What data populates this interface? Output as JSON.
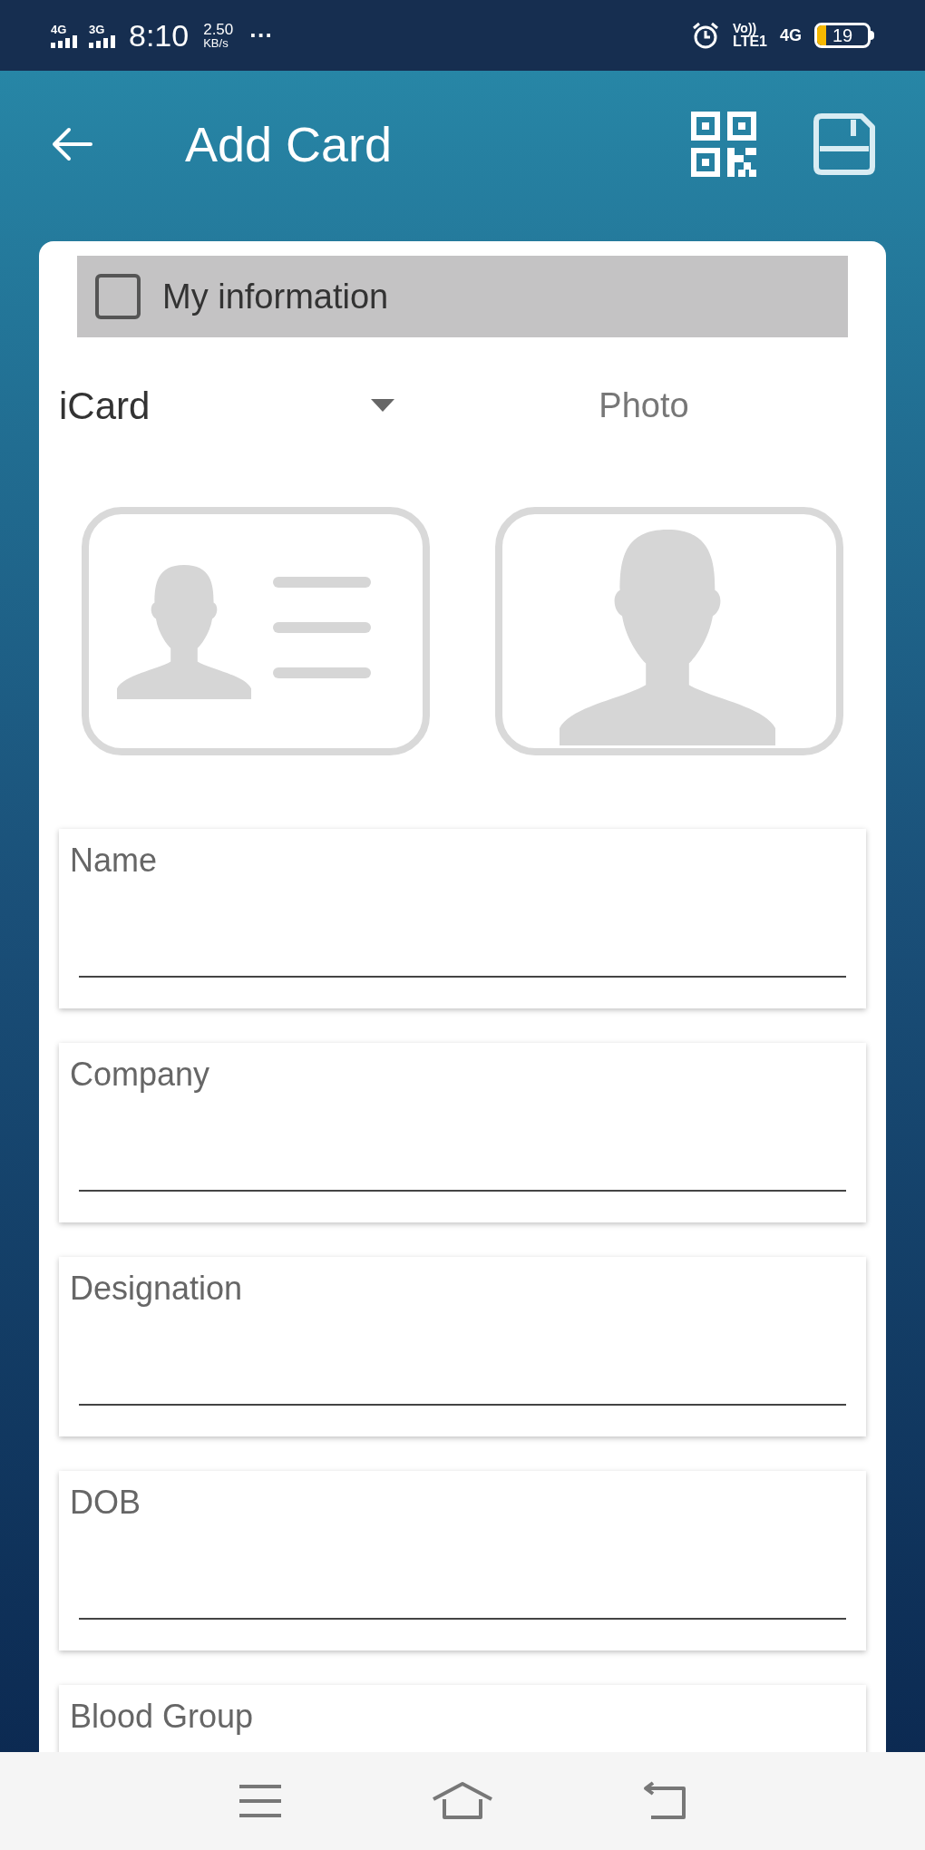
{
  "status_bar": {
    "signals": [
      "4G",
      "3G"
    ],
    "time": "8:10",
    "speed": {
      "value": "2.50",
      "unit": "KB/s"
    },
    "more": "···",
    "volte": {
      "top": "Vo))",
      "bottom": "LTE1"
    },
    "network": "4G",
    "battery": "19"
  },
  "header": {
    "title": "Add Card"
  },
  "my_information": {
    "label": "My information",
    "checked": false
  },
  "card_type": {
    "value": "iCard"
  },
  "photo_label": "Photo",
  "fields": [
    {
      "placeholder": "Name"
    },
    {
      "placeholder": "Company"
    },
    {
      "placeholder": "Designation"
    },
    {
      "placeholder": "DOB"
    },
    {
      "placeholder": "Blood Group"
    }
  ]
}
